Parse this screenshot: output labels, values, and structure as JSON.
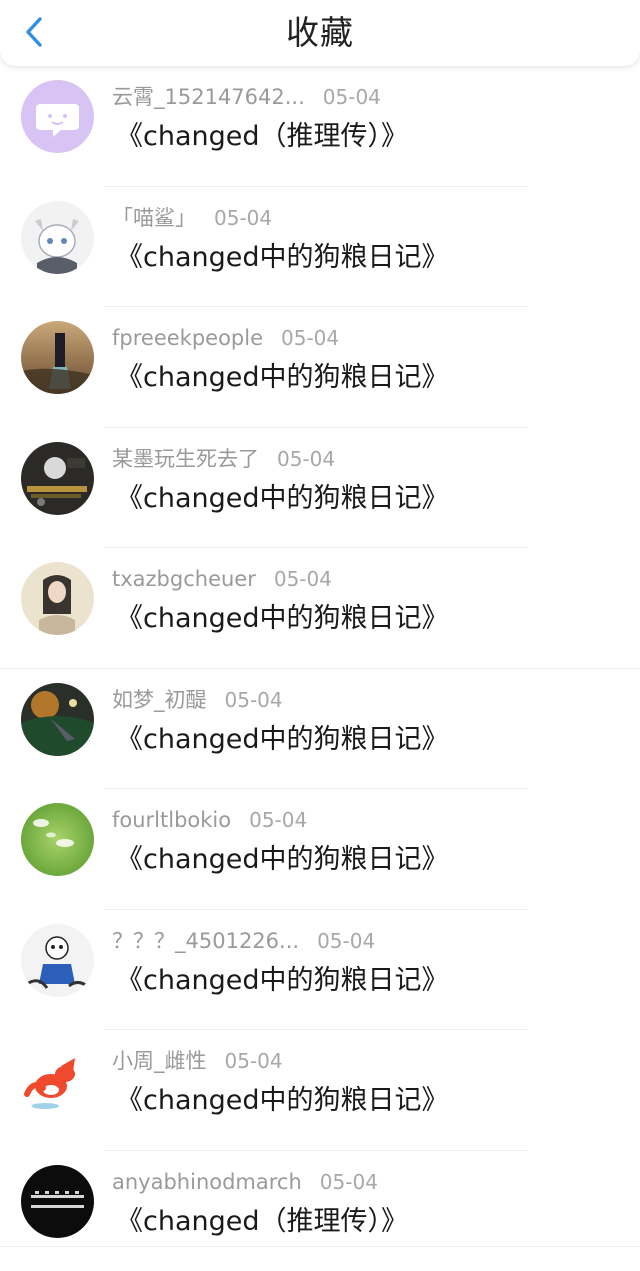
{
  "header": {
    "title": "收藏",
    "back_icon": "chevron-left-icon",
    "accent_color": "#2f8fe6"
  },
  "items": [
    {
      "user": "云霄_152147642...",
      "date": "05-04",
      "title": "《changed（推理传）》"
    },
    {
      "user": "「喵鲨」",
      "date": "05-04",
      "title": "《changed中的狗粮日记》"
    },
    {
      "user": "fpreeekpeople",
      "date": "05-04",
      "title": "《changed中的狗粮日记》"
    },
    {
      "user": "某墨玩生死去了",
      "date": "05-04",
      "title": "《changed中的狗粮日记》"
    },
    {
      "user": "txazbgcheuer",
      "date": "05-04",
      "title": "《changed中的狗粮日记》"
    },
    {
      "user": "如梦_初醍",
      "date": "05-04",
      "title": "《changed中的狗粮日记》"
    },
    {
      "user": "fourltlbokio",
      "date": "05-04",
      "title": "《changed中的狗粮日记》"
    },
    {
      "user": "？？？_4501226...",
      "date": "05-04",
      "title": "《changed中的狗粮日记》"
    },
    {
      "user": "小周_雌性",
      "date": "05-04",
      "title": "《changed中的狗粮日记》"
    },
    {
      "user": "anyabhinodmarch",
      "date": "05-04",
      "title": "《changed（推理传）》"
    }
  ]
}
